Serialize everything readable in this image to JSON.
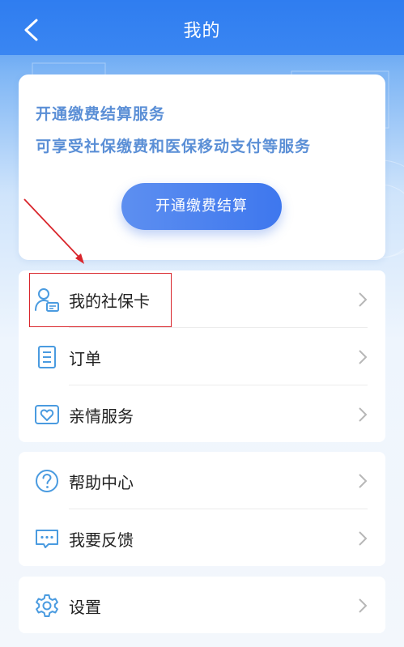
{
  "header": {
    "title": "我的",
    "back_icon": "chevron-left-icon"
  },
  "promo": {
    "line1": "开通缴费结算服务",
    "line2": "可享受社保缴费和医保移动支付等服务",
    "button_label": "开通缴费结算"
  },
  "menu_group1": [
    {
      "label": "我的社保卡",
      "icon": "social-security-card-icon"
    },
    {
      "label": "订单",
      "icon": "order-document-icon"
    },
    {
      "label": "亲情服务",
      "icon": "family-service-heart-icon"
    }
  ],
  "menu_group2": [
    {
      "label": "帮助中心",
      "icon": "help-question-icon"
    },
    {
      "label": "我要反馈",
      "icon": "feedback-chat-icon"
    }
  ],
  "menu_group3": [
    {
      "label": "设置",
      "icon": "settings-gear-icon"
    }
  ],
  "colors": {
    "header_blue": "#2f7df0",
    "icon_blue": "#4a9be0",
    "promo_text": "#5b8fd6",
    "annotation_red": "#d9262c"
  }
}
